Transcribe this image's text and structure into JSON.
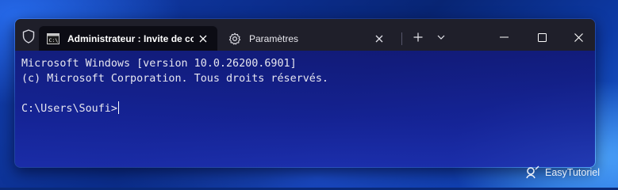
{
  "window": {
    "icons": {
      "shield": "shield-icon",
      "cmd": "cmd-icon",
      "settings": "gear-icon"
    },
    "tabs": [
      {
        "title": "Administrateur : Invite de commandes",
        "active": true,
        "icon": "cmd-icon"
      },
      {
        "title": "Paramètres",
        "active": false,
        "icon": "gear-icon"
      }
    ],
    "toolbar": {
      "new_tab": "+",
      "dropdown": "chevron-down-icon"
    },
    "controls": {
      "minimize": "minimize-icon",
      "maximize": "maximize-icon",
      "close": "close-icon"
    }
  },
  "terminal": {
    "lines": [
      "Microsoft Windows [version 10.0.26200.6901]",
      "(c) Microsoft Corporation. Tous droits réservés.",
      "",
      "C:\\Users\\Soufi>"
    ]
  },
  "watermark": {
    "text": "EasyTutoriel"
  },
  "colors": {
    "titlebar": "#1f1f2a",
    "active_tab": "#0c0c14",
    "terminal_text": "#e6e6f0"
  }
}
